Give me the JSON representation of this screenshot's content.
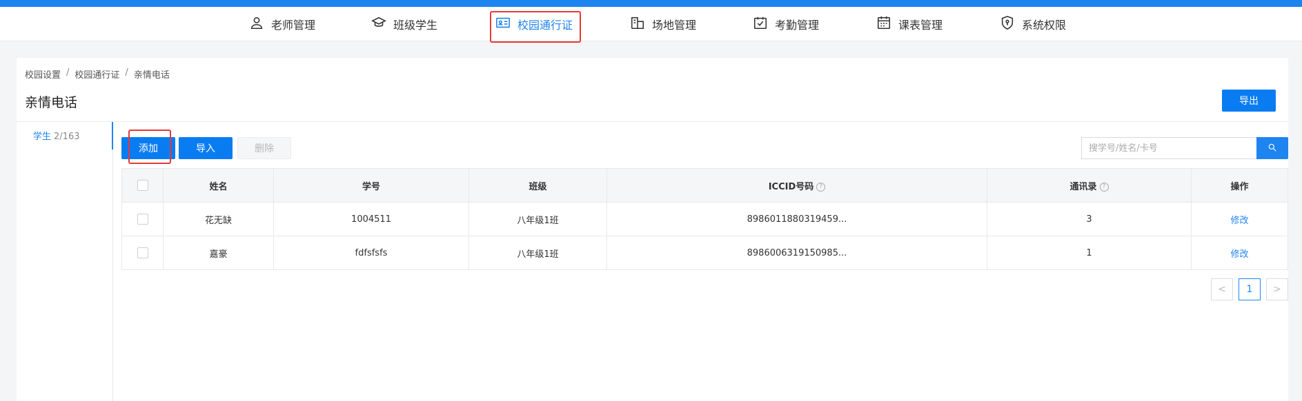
{
  "nav": {
    "items": [
      {
        "label": "老师管理",
        "icon": "user-icon"
      },
      {
        "label": "班级学生",
        "icon": "graduation-cap-icon"
      },
      {
        "label": "校园通行证",
        "icon": "id-card-icon",
        "active": true
      },
      {
        "label": "场地管理",
        "icon": "building-icon"
      },
      {
        "label": "考勤管理",
        "icon": "calendar-check-icon"
      },
      {
        "label": "课表管理",
        "icon": "calendar-icon"
      },
      {
        "label": "系统权限",
        "icon": "shield-icon"
      }
    ]
  },
  "breadcrumb": [
    "校园设置",
    "校园通行证",
    "亲情电话"
  ],
  "breadcrumb_sep": "/",
  "page_title": "亲情电话",
  "export_label": "导出",
  "sidebar": {
    "label": "学生",
    "count": "2/163"
  },
  "toolbar": {
    "add": "添加",
    "import": "导入",
    "delete": "删除"
  },
  "search": {
    "placeholder": "搜学号/姓名/卡号"
  },
  "table": {
    "headers": [
      "姓名",
      "学号",
      "班级",
      "ICCID号码",
      "通讯录",
      "操作"
    ],
    "help_headers": [
      "ICCID号码",
      "通讯录"
    ],
    "rows": [
      {
        "name": "花无缺",
        "id": "1004511",
        "class": "八年级1班",
        "iccid": "8986011880319459...",
        "contacts": "3",
        "action": "修改"
      },
      {
        "name": "嘉豪",
        "id": "fdfsfsfs",
        "class": "八年级1班",
        "iccid": "8986006319150985...",
        "contacts": "1",
        "action": "修改"
      }
    ]
  },
  "pagination": {
    "prev": "<",
    "current": "1",
    "next": ">"
  },
  "colors": {
    "accent": "#1e84f0",
    "highlight_box": "#e53935"
  }
}
